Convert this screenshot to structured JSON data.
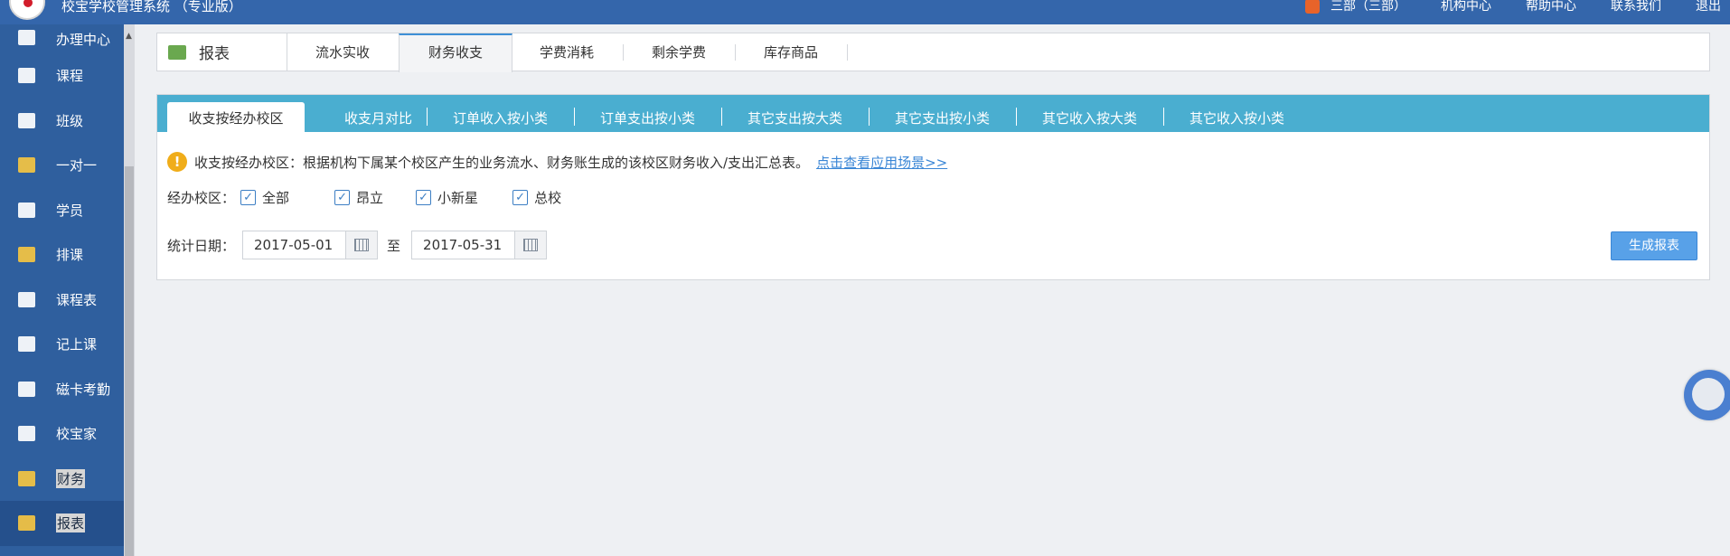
{
  "app": {
    "title": "校宝学校管理系统 （专业版）"
  },
  "top_nav": {
    "user": "三部（三部）",
    "org_center": "机构中心",
    "help_center": "帮助中心",
    "contact": "联系我们",
    "logout": "退出"
  },
  "sidebar": {
    "items": [
      {
        "label": "办理中心",
        "icon": "handle-center-icon"
      },
      {
        "label": "课程",
        "icon": "course-icon"
      },
      {
        "label": "班级",
        "icon": "class-icon"
      },
      {
        "label": "一对一",
        "icon": "one-on-one-icon"
      },
      {
        "label": "学员",
        "icon": "student-icon"
      },
      {
        "label": "排课",
        "icon": "schedule-icon"
      },
      {
        "label": "课程表",
        "icon": "timetable-icon"
      },
      {
        "label": "记上课",
        "icon": "attendance-record-icon"
      },
      {
        "label": "磁卡考勤",
        "icon": "card-attendance-icon"
      },
      {
        "label": "校宝家",
        "icon": "xiaobao-home-icon"
      },
      {
        "label": "财务",
        "icon": "finance-icon"
      },
      {
        "label": "报表",
        "icon": "report-icon"
      }
    ]
  },
  "main_tabs": {
    "title": "报表",
    "tabs": [
      "流水实收",
      "财务收支",
      "学费消耗",
      "剩余学费",
      "库存商品"
    ],
    "active": "财务收支"
  },
  "sub_tabs": {
    "tabs": [
      "收支按经办校区",
      "收支月对比",
      "订单收入按小类",
      "订单支出按小类",
      "其它支出按大类",
      "其它支出按小类",
      "其它收入按大类",
      "其它收入按小类"
    ],
    "active": "收支按经办校区"
  },
  "notice": {
    "text": "收支按经办校区：根据机构下属某个校区产生的业务流水、财务账生成的该校区财务收入/支出汇总表。",
    "link": "点击查看应用场景>>"
  },
  "campus_filter": {
    "label": "经办校区：",
    "options": [
      {
        "label": "全部",
        "checked": true
      },
      {
        "label": "昂立",
        "checked": true
      },
      {
        "label": "小新星",
        "checked": true
      },
      {
        "label": "总校",
        "checked": true
      }
    ]
  },
  "date_filter": {
    "label": "统计日期：",
    "start": "2017-05-01",
    "separator": "至",
    "end": "2017-05-31"
  },
  "generate_button": "生成报表",
  "colors": {
    "topbar": "#3466ab",
    "sidebar": "#2f5f9e",
    "subtab_bar": "#4aaed0",
    "primary_button": "#58a1e8",
    "warning": "#f0ad1a"
  }
}
